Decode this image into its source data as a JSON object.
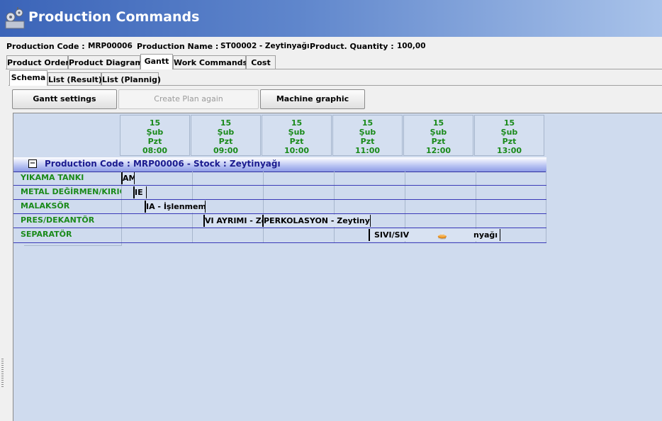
{
  "window": {
    "title": "Production Commands",
    "icon": "gears-icon"
  },
  "info": {
    "production_code_label": "Production Code  :",
    "production_code_value": "MRP00006",
    "production_name_label": "Production Name  :",
    "production_name_value": "ST00002 - Zeytinyağı",
    "product_quantity_label": "Product. Quantity  :",
    "product_quantity_value": "100,00"
  },
  "tabs": [
    "Product Order",
    "Product Diagram",
    "Gantt",
    "Work Commands",
    "Cost"
  ],
  "active_tab": "Gantt",
  "subtabs": [
    "Schema",
    "List (Result)",
    "List (Plannig)"
  ],
  "active_subtab": "Schema",
  "buttons": {
    "gantt_settings": "Gantt settings",
    "create_plan_again": "Create Plan again",
    "machine_graphic": "Machine graphic"
  },
  "timeline": [
    {
      "day": "15",
      "month": "Şub",
      "weekday": "Pzt",
      "time": "08:00"
    },
    {
      "day": "15",
      "month": "Şub",
      "weekday": "Pzt",
      "time": "09:00"
    },
    {
      "day": "15",
      "month": "Şub",
      "weekday": "Pzt",
      "time": "10:00"
    },
    {
      "day": "15",
      "month": "Şub",
      "weekday": "Pzt",
      "time": "11:00"
    },
    {
      "day": "15",
      "month": "Şub",
      "weekday": "Pzt",
      "time": "12:00"
    },
    {
      "day": "15",
      "month": "Şub",
      "weekday": "Pzt",
      "time": "13:00"
    }
  ],
  "group": {
    "title": "Production Code : MRP00006  -  Stock : Zeytinyağı"
  },
  "rows": [
    "YIKAMA TANKI",
    "METAL DEĞİRMEN/KIRICI",
    "MALAKSÖR",
    "PRES/DEKANTÖR",
    "SEPARATÖR"
  ],
  "tasks": [
    {
      "label": "AM"
    },
    {
      "label": "IE -"
    },
    {
      "label": "IA - İşlenmemi"
    },
    {
      "label": "VI AYRIMI - Ze"
    },
    {
      "label": "PERKOLASYON - Zeytinyağı"
    },
    {
      "label": "SIVI/SIV"
    },
    {
      "label": "nyağı"
    }
  ],
  "colors": {
    "title_start": "#3b64b8",
    "gantt_bg": "#cfdbee",
    "label_green": "#1a8a1a"
  }
}
